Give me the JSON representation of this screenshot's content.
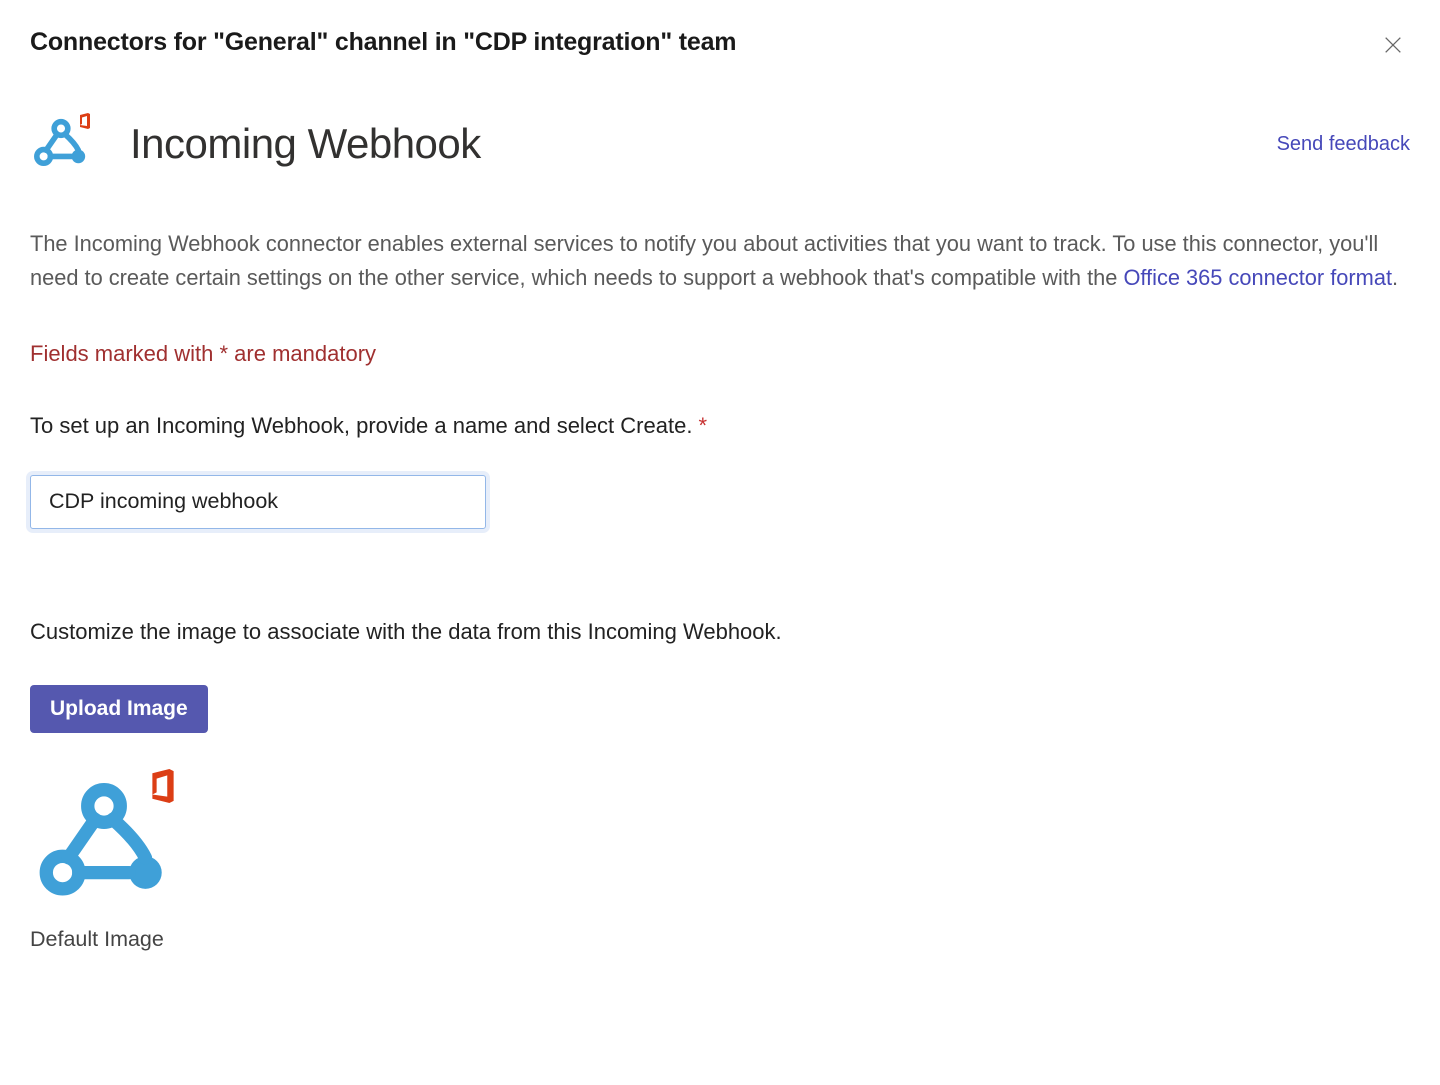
{
  "dialog": {
    "title": "Connectors for \"General\" channel in \"CDP integration\" team"
  },
  "app": {
    "title": "Incoming Webhook",
    "feedback_link": "Send feedback"
  },
  "description": {
    "text_part1": "The Incoming Webhook connector enables external services to notify you about activities that you want to track. To use this connector, you'll need to create certain settings on the other service, which needs to support a webhook that's compatible with the ",
    "link_text": "Office 365 connector format",
    "text_part2": "."
  },
  "mandatory_notice": "Fields marked with * are mandatory",
  "instruction": {
    "text": "To set up an Incoming Webhook, provide a name and select Create. ",
    "asterisk": "*"
  },
  "form": {
    "name_value": "CDP incoming webhook"
  },
  "customize_text": "Customize the image to associate with the data from this Incoming Webhook.",
  "upload_button_label": "Upload Image",
  "default_image_label": "Default Image"
}
